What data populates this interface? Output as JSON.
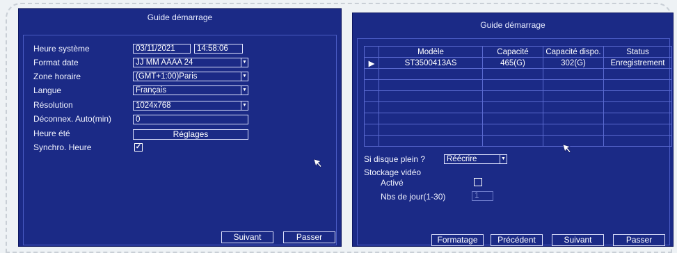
{
  "left_panel": {
    "title": "Guide démarrage",
    "system_time": {
      "label": "Heure système",
      "date": "03/11/2021",
      "time": "14:58:06"
    },
    "date_format": {
      "label": "Format date",
      "value": "JJ MM AAAA 24"
    },
    "timezone": {
      "label": "Zone horaire",
      "value": "(GMT+1:00)Paris"
    },
    "language": {
      "label": "Langue",
      "value": "Français"
    },
    "resolution": {
      "label": "Résolution",
      "value": "1024x768"
    },
    "auto_logout": {
      "label": "Déconnex. Auto(min)",
      "value": "0"
    },
    "dst": {
      "label": "Heure été",
      "button": "Réglages"
    },
    "sync_time": {
      "label": "Synchro. Heure",
      "checked": true,
      "check_glyph": "✓"
    },
    "buttons": {
      "next": "Suivant",
      "skip": "Passer"
    }
  },
  "right_panel": {
    "title": "Guide démarrage",
    "table": {
      "headers": [
        "Modèle",
        "Capacité",
        "Capacité dispo.",
        "Status"
      ],
      "rows": [
        {
          "marker": "▶",
          "model": "ST3500413AS",
          "capacity": "465(G)",
          "available": "302(G)",
          "status": "Enregistrement"
        }
      ],
      "empty_rows": 7
    },
    "disk_full": {
      "label": "Si disque plein ?",
      "value": "Réécrire"
    },
    "video_storage": {
      "label": "Stockage vidéo",
      "active_label": "Activé",
      "active_checked": false,
      "days_label": "Nbs de jour(1-30)",
      "days_value": "1"
    },
    "buttons": {
      "format": "Formatage",
      "previous": "Précédent",
      "next": "Suivant",
      "skip": "Passer"
    }
  },
  "icons": {
    "dropdown": "dropdown-arrow-icon",
    "cursor": "mouse-pointer-icon",
    "row_marker": "play-triangle-icon"
  },
  "colors": {
    "panel_bg": "#1b2a86",
    "border": "#e0e4ff"
  }
}
